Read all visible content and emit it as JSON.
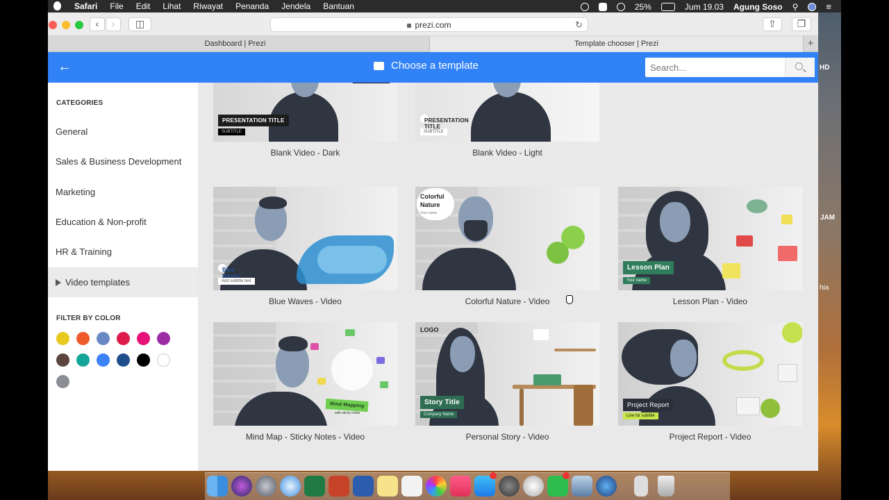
{
  "menubar": {
    "menus": [
      "Safari",
      "File",
      "Edit",
      "Lihat",
      "Riwayat",
      "Penanda",
      "Jendela",
      "Bantuan"
    ],
    "battery": "25%",
    "clock": "Jum 19.03",
    "user": "Agung Soso"
  },
  "desktop_labels": {
    "hd": "HD",
    "jam": "JAM",
    "hia": "hia"
  },
  "browser": {
    "url": "prezi.com",
    "tabs": [
      "Dashboard | Prezi",
      "Template chooser | Prezi"
    ],
    "new_tab": "+"
  },
  "header": {
    "back": "←",
    "title": "Choose a template",
    "search_placeholder": "Search..."
  },
  "sidebar": {
    "categories_title": "CATEGORIES",
    "categories": [
      {
        "label": "General"
      },
      {
        "label": "Sales & Business Development"
      },
      {
        "label": "Marketing"
      },
      {
        "label": "Education & Non-profit"
      },
      {
        "label": "HR & Training"
      },
      {
        "label": "Video templates",
        "selected": true
      }
    ],
    "filter_title": "FILTER BY COLOR",
    "colors": [
      "#e8c91e",
      "#ef5a2b",
      "#6a89c4",
      "#dc1a4b",
      "#e6127a",
      "#9b2ea5",
      "#5b453c",
      "#14a599",
      "#3a82f7",
      "#1e4e8c",
      "#000000",
      "#ffffff",
      "#8a8e93"
    ]
  },
  "templates": [
    {
      "name": "Blank Video - Dark",
      "thumb_title": "PRESENTATION TITLE",
      "thumb_sub": "SUBTITLE"
    },
    {
      "name": "Blank Video - Light",
      "thumb_title": "PRESENTATION TITLE",
      "thumb_sub": "SUBTITLE"
    },
    {
      "name": "Blue Waves - Video",
      "thumb_title": "Blue Waves",
      "thumb_sub": "Add subtitle text"
    },
    {
      "name": "Colorful Nature - Video",
      "thumb_title": "Colorful Nature",
      "thumb_sub": "Your name"
    },
    {
      "name": "Lesson Plan - Video",
      "thumb_title": "Lesson Plan",
      "thumb_sub": "Your name"
    },
    {
      "name": "Mind Map - Sticky Notes - Video",
      "thumb_title": "Mind Mapping",
      "thumb_sub": "with sticky notes"
    },
    {
      "name": "Personal Story - Video",
      "thumb_title": "Story Title",
      "thumb_sub": "Company Name",
      "logo": "LOGO"
    },
    {
      "name": "Project Report - Video",
      "thumb_title": "Project Report",
      "thumb_sub": "Line for subtitle"
    }
  ],
  "colors": {
    "accent": "#3182f6",
    "sidebar_selected": "#ebebeb",
    "main_bg": "#e9e9e9"
  }
}
